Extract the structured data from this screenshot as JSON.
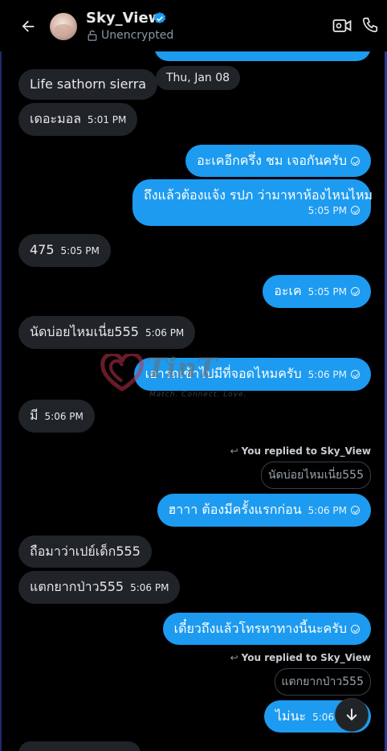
{
  "header": {
    "contact_name": "Sky_View",
    "encryption_status": "Unencrypted",
    "icons": [
      "back-arrow-icon",
      "verified-badge-icon",
      "unlock-icon",
      "video-call-icon",
      "phone-icon"
    ]
  },
  "date_divider": "Thu, Jan 08",
  "messages": [
    {
      "id": "m1",
      "dir": "in",
      "text": "Life sathorn sierra",
      "time": ""
    },
    {
      "id": "m2",
      "dir": "in",
      "text": "เดอะมอล",
      "time": "5:01 PM"
    },
    {
      "id": "m3",
      "dir": "out",
      "text": "อะเคอีกครึ่ง ชม เจอกันครับ",
      "time": ""
    },
    {
      "id": "m4",
      "dir": "out",
      "text": "ถึงแล้วต้องแจ้ง รปภ ว่ามาหาห้องไหนไหม",
      "time": "5:05 PM"
    },
    {
      "id": "m5",
      "dir": "in",
      "text": "475",
      "time": "5:05 PM"
    },
    {
      "id": "m6",
      "dir": "out",
      "text": "อะเค",
      "time": "5:05 PM"
    },
    {
      "id": "m7",
      "dir": "in",
      "text": "นัดบ่อยไหมเนี่ย555",
      "time": "5:06 PM"
    },
    {
      "id": "m8",
      "dir": "out",
      "text": "เอารถเข้าไปมีที่จอดไหมครับ",
      "time": "5:06 PM"
    },
    {
      "id": "m9",
      "dir": "in",
      "text": "มี",
      "time": "5:06 PM"
    },
    {
      "id": "m10",
      "dir": "out",
      "text": "ฮาาา ต้องมีครั้งแรกก่อน",
      "time": "5:06 PM"
    },
    {
      "id": "m11",
      "dir": "in",
      "text": "ถือมาว่าเปย์เด็ก555",
      "time": ""
    },
    {
      "id": "m12",
      "dir": "in",
      "text": "แตกยากป่าว555",
      "time": "5:06 PM"
    },
    {
      "id": "m13",
      "dir": "out",
      "text": "เดี๋ยวถึงแล้วโทรหาทางนี้นะครับ",
      "time": ""
    },
    {
      "id": "m14",
      "dir": "out",
      "text": "ไม่นะ",
      "time": "5:06 P"
    }
  ],
  "replies": [
    {
      "label": "You replied to Sky_View",
      "quoted": "นัดบ่อยไหมเนี่ย555"
    },
    {
      "label": "You replied to Sky_View",
      "quoted": "แตกยากป่าว555"
    }
  ],
  "watermark": {
    "brand": "TinT",
    "tagline": "Match. Connect. Love."
  },
  "colors": {
    "outgoing_bubble": "#1d9bf0",
    "incoming_bubble": "#202327",
    "background": "#000000",
    "verified": "#1d9bf0"
  }
}
